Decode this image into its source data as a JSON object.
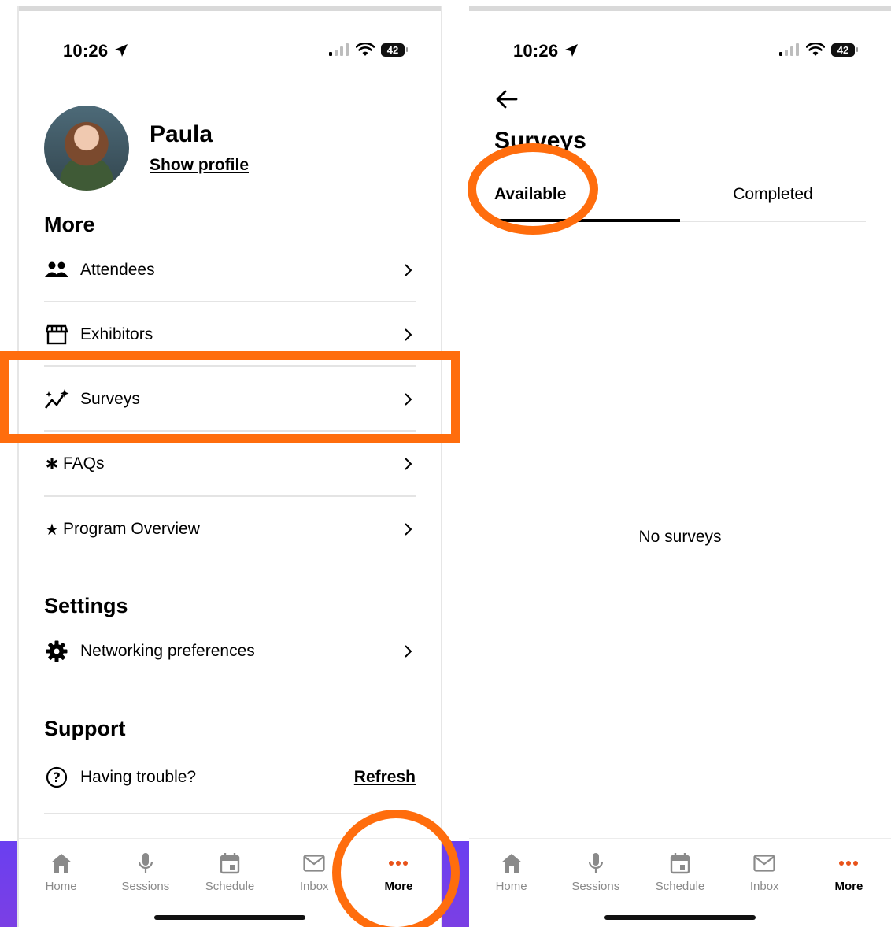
{
  "left_screen": {
    "status": {
      "time": "10:26",
      "battery": "42"
    },
    "profile": {
      "name": "Paula",
      "show_profile": "Show profile"
    },
    "more_section": {
      "title": "More",
      "items": [
        {
          "label": "Attendees",
          "icon": "people-icon"
        },
        {
          "label": "Exhibitors",
          "icon": "storefront-icon"
        },
        {
          "label": "Surveys",
          "icon": "sparkle-chart-icon"
        },
        {
          "label": "FAQs",
          "icon": "asterisk-icon",
          "prefix": "✱"
        },
        {
          "label": "Program Overview",
          "icon": "star-icon",
          "prefix": "★"
        }
      ]
    },
    "settings_section": {
      "title": "Settings",
      "items": [
        {
          "label": "Networking preferences",
          "icon": "gear-icon"
        }
      ]
    },
    "support_section": {
      "title": "Support",
      "trouble_label": "Having trouble?",
      "refresh_label": "Refresh"
    }
  },
  "right_screen": {
    "status": {
      "time": "10:26",
      "battery": "42"
    },
    "title": "Surveys",
    "tabs": [
      {
        "label": "Available",
        "active": true
      },
      {
        "label": "Completed",
        "active": false
      }
    ],
    "empty_message": "No surveys"
  },
  "tab_bar": [
    {
      "label": "Home",
      "icon": "home-icon"
    },
    {
      "label": "Sessions",
      "icon": "microphone-icon"
    },
    {
      "label": "Schedule",
      "icon": "calendar-icon"
    },
    {
      "label": "Inbox",
      "icon": "mail-icon"
    },
    {
      "label": "More",
      "icon": "more-dots-icon",
      "active": true
    }
  ],
  "colors": {
    "annotation": "#ff6d0d",
    "accent_more": "#e8521a",
    "tab_inactive": "#8a8a8a",
    "background_purple": "#6a3ff0"
  }
}
